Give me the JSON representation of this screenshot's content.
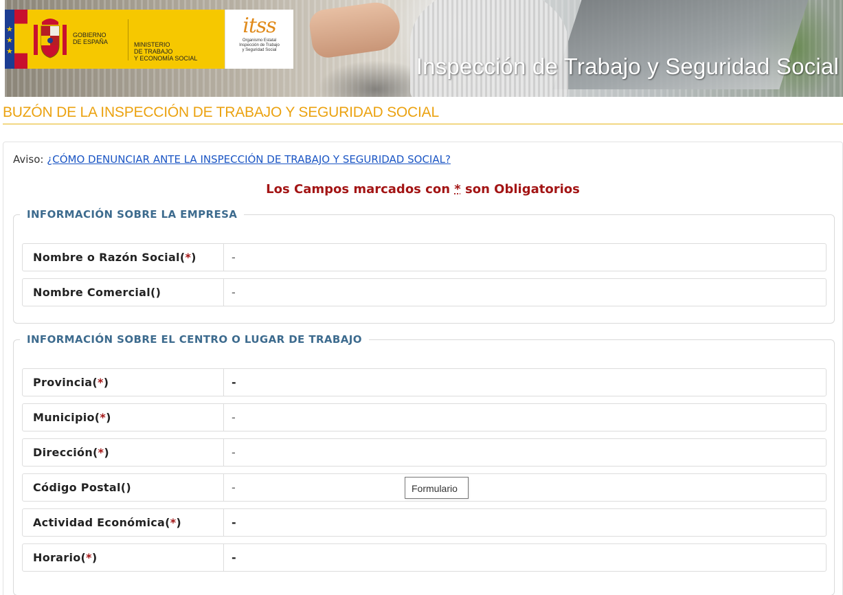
{
  "banner": {
    "title": "Inspección de Trabajo y Seguridad Social",
    "gobierno_line1": "GOBIERNO",
    "gobierno_line2": "DE ESPAÑA",
    "ministerio_line1": "MINISTERIO",
    "ministerio_line2": "DE TRABAJO",
    "ministerio_line3": "Y ECONOMÍA SOCIAL",
    "itss_logo": "itss",
    "itss_sub1": "Organismo Estatal",
    "itss_sub2": "Inspección de Trabajo",
    "itss_sub3": "y Seguridad Social"
  },
  "page": {
    "title": "BUZÓN DE LA INSPECCIÓN DE TRABAJO Y SEGURIDAD SOCIAL"
  },
  "aviso": {
    "prefix": "Aviso:",
    "link": "¿CÓMO DENUNCIAR ANTE LA INSPECCIÓN DE TRABAJO Y SEGURIDAD SOCIAL?"
  },
  "required_note": {
    "before": "Los Campos marcados con",
    "star": "*",
    "after": "son Obligatorios"
  },
  "empresa": {
    "legend": "INFORMACIÓN SOBRE LA EMPRESA",
    "fields": [
      {
        "label": "Nombre o Razón Social",
        "required": "*",
        "value": "-"
      },
      {
        "label": "Nombre Comercial",
        "required": " ",
        "value": "-"
      }
    ]
  },
  "centro": {
    "legend": "INFORMACIÓN SOBRE EL CENTRO O LUGAR DE TRABAJO",
    "fields": [
      {
        "label": "Provincia",
        "required": "*",
        "value": "-"
      },
      {
        "label": "Municipio",
        "required": "*",
        "value": "-"
      },
      {
        "label": "Dirección",
        "required": "*",
        "value": "-"
      },
      {
        "label": "Código Postal",
        "required": " ",
        "value": "-"
      },
      {
        "label": "Actividad Económica",
        "required": "*",
        "value": "-"
      },
      {
        "label": "Horario",
        "required": "*",
        "value": "-"
      }
    ]
  },
  "tooltip": {
    "text": "Formulario"
  },
  "colors": {
    "title_orange": "#eba210",
    "legend_blue": "#3d6b8e",
    "required_red": "#a31515",
    "link_blue": "#1a55c4"
  }
}
